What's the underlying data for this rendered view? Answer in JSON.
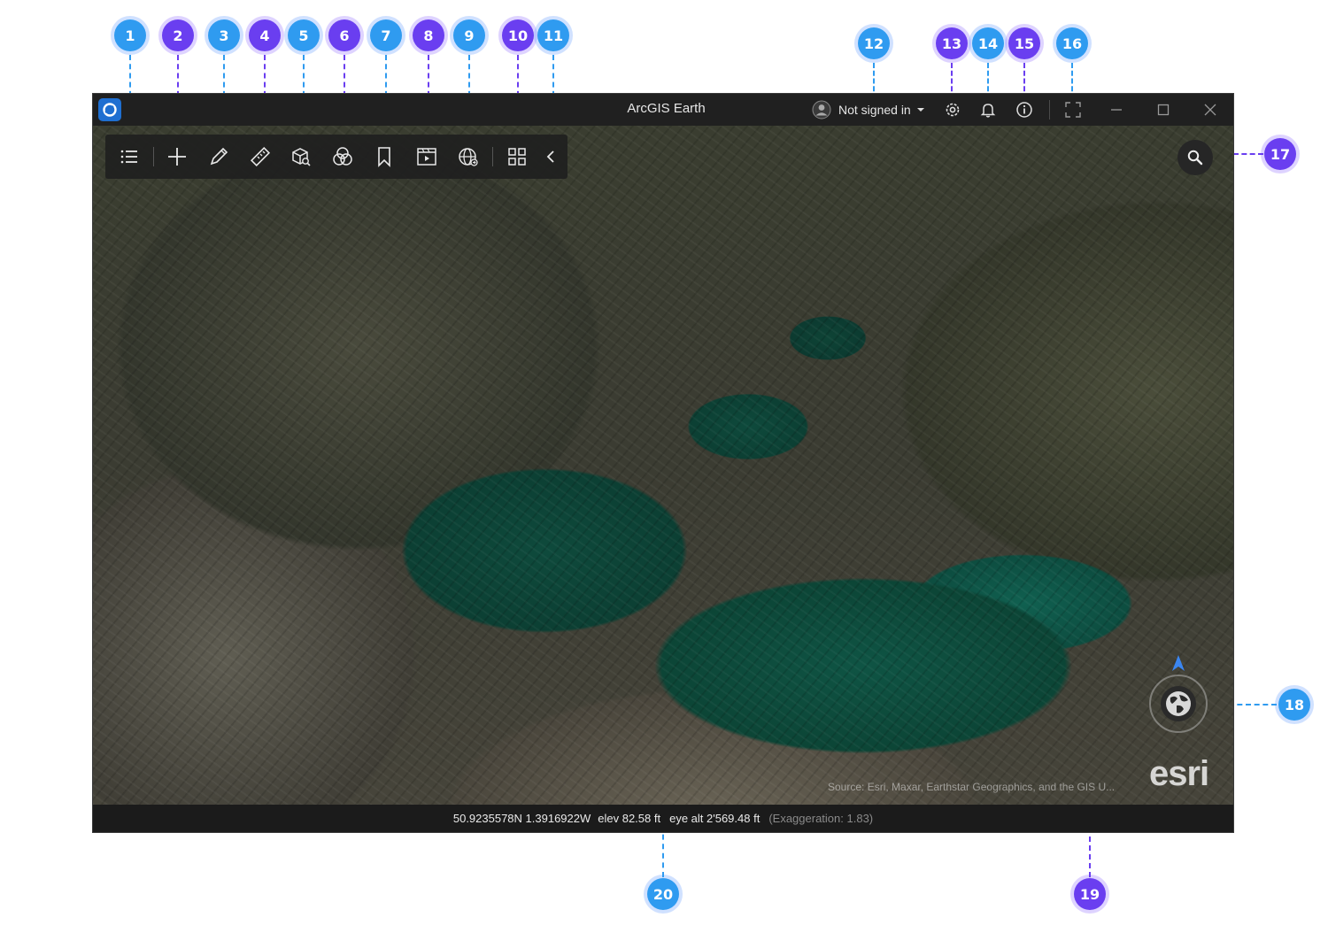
{
  "window": {
    "title": "ArcGIS Earth",
    "sign_in_label": "Not signed in",
    "controls": [
      "minimize-icon",
      "maximize-icon",
      "close-icon"
    ]
  },
  "toolbar": {
    "tools": [
      {
        "name": "contents-icon"
      },
      {
        "name": "add-data-icon"
      },
      {
        "name": "draw-icon"
      },
      {
        "name": "measure-icon"
      },
      {
        "name": "3d-analysis-icon"
      },
      {
        "name": "overlay-icon"
      },
      {
        "name": "bookmark-icon"
      },
      {
        "name": "tour-icon"
      },
      {
        "name": "geoprocessing-icon"
      },
      {
        "name": "workspace-grid-icon"
      },
      {
        "name": "collapse-icon"
      }
    ]
  },
  "callouts": [
    "1",
    "2",
    "3",
    "4",
    "5",
    "6",
    "7",
    "8",
    "9",
    "10",
    "11",
    "12",
    "13",
    "14",
    "15",
    "16",
    "17",
    "18",
    "19",
    "20"
  ],
  "map": {
    "attribution": "Source: Esri, Maxar, Earthstar Geographics, and the GIS U...",
    "logo_text": "esri"
  },
  "status": {
    "coordinates": "50.9235578N 1.3916922W",
    "elevation": "elev 82.58 ft",
    "eye_altitude": "eye alt 2'569.48 ft",
    "exaggeration": "(Exaggeration: 1.83)"
  },
  "colors": {
    "callout_blue": "#2f9bf0",
    "callout_purple": "#6a3ef0",
    "titlebar_bg": "#202020",
    "water": "#0d4a3c"
  }
}
